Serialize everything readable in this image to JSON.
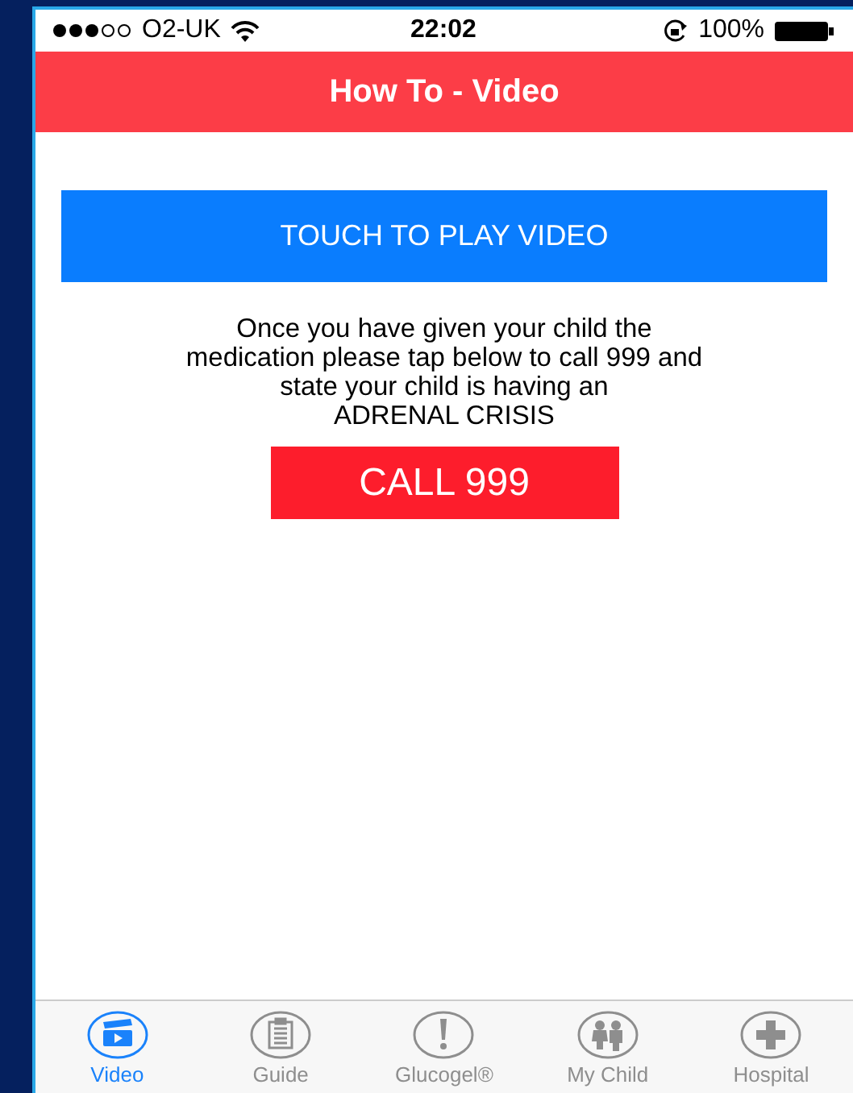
{
  "status_bar": {
    "carrier": "O2-UK",
    "time": "22:02",
    "battery": "100%"
  },
  "nav_bar": {
    "title": "How To - Video"
  },
  "play_button": {
    "label": "TOUCH TO PLAY VIDEO"
  },
  "instructions": "Once you have given your child the\nmedication please tap below to call 999 and\nstate your child is having an\nADRENAL CRISIS",
  "call_button": {
    "label": "CALL 999"
  },
  "tab_bar": [
    {
      "kind": "video",
      "label": "Video",
      "selected": true
    },
    {
      "kind": "guide",
      "label": "Guide",
      "selected": false
    },
    {
      "kind": "alert",
      "label": "Glucogel®",
      "selected": false
    },
    {
      "kind": "children",
      "label": "My Child",
      "selected": false
    },
    {
      "kind": "plus",
      "label": "Hospital",
      "selected": false
    }
  ]
}
